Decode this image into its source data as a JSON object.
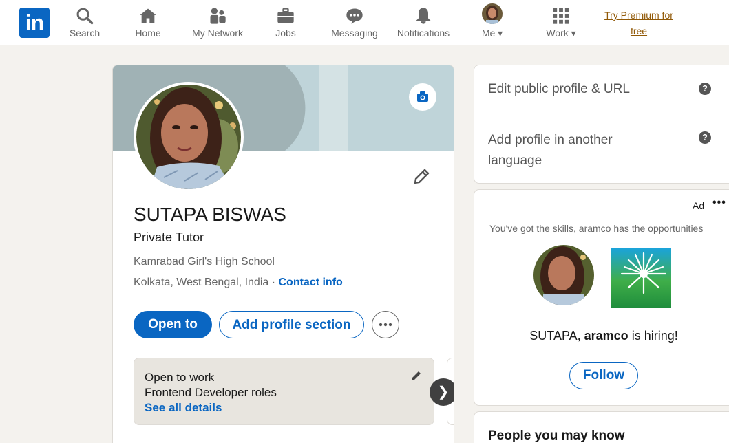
{
  "colors": {
    "brand": "#0a66c2",
    "premium": "#915907",
    "page_bg": "#f4f2ee"
  },
  "nav": {
    "logo_text": "in",
    "items": [
      {
        "label": "Search",
        "icon": "search-icon"
      },
      {
        "label": "Home",
        "icon": "home-icon"
      },
      {
        "label": "My Network",
        "icon": "network-icon"
      },
      {
        "label": "Jobs",
        "icon": "briefcase-icon"
      },
      {
        "label": "Messaging",
        "icon": "messaging-icon"
      },
      {
        "label": "Notifications",
        "icon": "bell-icon"
      },
      {
        "label": "Me",
        "icon": "avatar"
      }
    ],
    "work_label": "Work",
    "premium_line1": "Try Premium for",
    "premium_line2": "free"
  },
  "profile": {
    "name": "SUTAPA BISWAS",
    "headline": "Private Tutor",
    "school": "Kamrabad Girl's High School",
    "location": "Kolkata, West Bengal, India",
    "location_sep": " · ",
    "contact_label": "Contact info",
    "open_to_label": "Open to",
    "add_section_label": "Add profile section",
    "open_to_work": {
      "title": "Open to work",
      "roles": "Frontend Developer roles",
      "link": "See all details"
    }
  },
  "rail": {
    "edit_public": "Edit public profile & URL",
    "add_language": "Add profile in another language",
    "ad": {
      "label": "Ad",
      "more": "•••",
      "tagline": "You've got the skills, aramco has the opportunities",
      "hiring_prefix": "SUTAPA, ",
      "hiring_company": "aramco",
      "hiring_suffix": " is hiring!",
      "follow_label": "Follow"
    },
    "pymk_title": "People you may know"
  }
}
